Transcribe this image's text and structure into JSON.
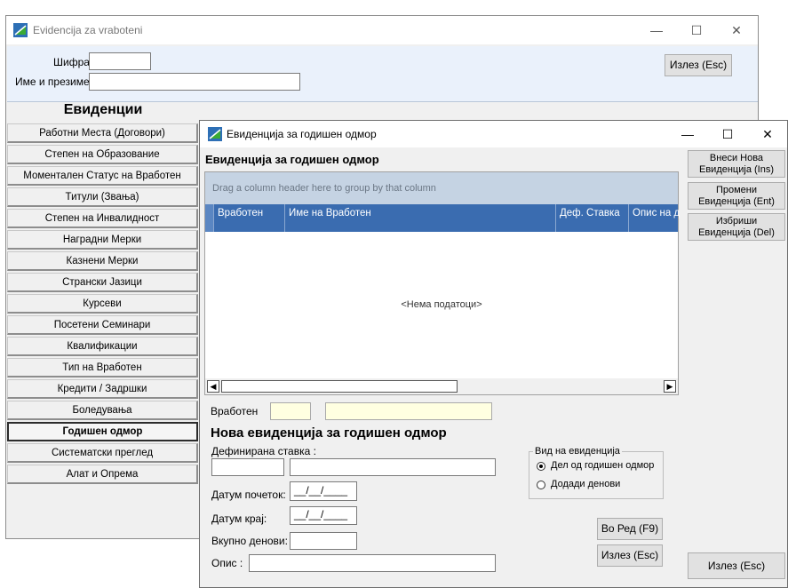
{
  "main_window": {
    "title": "Evidencija za vraboteni",
    "code_label": "Шифра:",
    "code_value": "",
    "name_label": "Име и презиме:",
    "name_value": "",
    "exit_button": "Излез (Esc)",
    "nav_heading": "Евиденции",
    "nav_items": [
      "Работни Места (Договори)",
      "Степен на Образование",
      "Моментален Статус на Вработен",
      "Титули (Звања)",
      "Степен на Инвалидност",
      "Наградни Мерки",
      "Казнени Мерки",
      "Странски Јазици",
      "Курсеви",
      "Посетени Семинари",
      "Квалификации",
      "Тип на Вработен",
      "Кредити / Задршки",
      "Боледувања",
      "Годишен одмор",
      "Систематски преглед",
      "Алат и Опрема"
    ],
    "active_nav": "Годишен одмор"
  },
  "dialog": {
    "title": "Евиденција за годишен одмор",
    "heading": "Евиденција за годишен одмор",
    "grid": {
      "group_hint": "Drag a column header here to group by that column",
      "columns": [
        "Вработен",
        "Име на Вработен",
        "Деф. Ставка",
        "Опис на де"
      ],
      "empty_text": "<Нема податоци>"
    },
    "employee_label": "Вработен",
    "employee_code": "",
    "employee_name": "",
    "new_heading": "Нова евиденција за годишен одмор",
    "defined_item_label": "Дефинирана ставка :",
    "defined_item_code": "",
    "defined_item_name": "",
    "start_date_label": "Датум почеток:",
    "start_date_value": "__/__/____",
    "end_date_label": "Датум крај:",
    "end_date_value": "__/__/____",
    "total_days_label": "Вкупно денови:",
    "total_days_value": "",
    "description_label": "Опис :",
    "description_value": "",
    "type_group": {
      "legend": "Вид на евиденција",
      "options": [
        "Дел од годишен одмор",
        "Додади денови"
      ],
      "selected": "Дел од годишен одмор"
    },
    "ok_button": "Во Ред (F9)",
    "exit_button": "Излез (Esc)",
    "side_buttons": {
      "insert": "Внеси Нова Евиденција (Ins)",
      "edit": "Промени Евиденција (Ent)",
      "delete": "Избриши Евиденција (Del)",
      "exit": "Излез (Esc)"
    }
  }
}
